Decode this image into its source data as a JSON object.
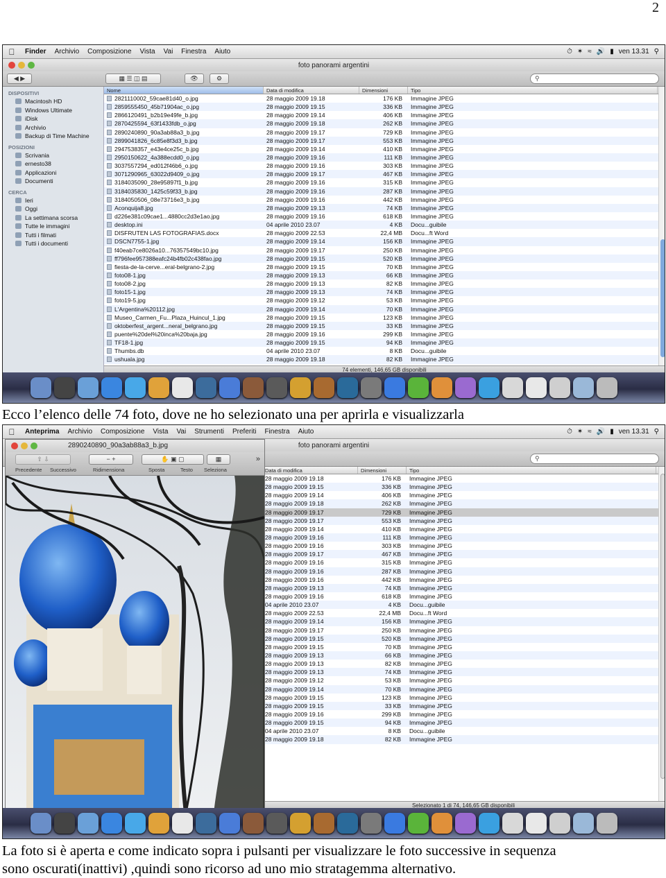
{
  "page_number": "2",
  "caption1": "Ecco l’elenco delle 74 foto, dove ne ho selezionato una per aprirla e visualizzarla",
  "caption2_line1": "La foto si è aperta e come indicato sopra i pulsanti per visualizzare le foto successive in sequenza",
  "caption2_line2": "sono oscurati(inattivi) ,quindi sono ricorso ad uno mio stratagemma alternativo.",
  "shot1": {
    "menu": [
      "Finder",
      "Archivio",
      "Composizione",
      "Vista",
      "Vai",
      "Finestra",
      "Aiuto"
    ],
    "clock": "ven 13.31",
    "window_title": "foto panorami argentini",
    "sidebar": {
      "dispositivi": "DISPOSITIVI",
      "devices": [
        "Macintosh HD",
        "Windows Ultimate",
        "iDisk",
        "Archivio",
        "Backup di Time Machine"
      ],
      "posizioni": "POSIZIONI",
      "places": [
        "Scrivania",
        "ernesto38",
        "Applicazioni",
        "Documenti"
      ],
      "cerca": "CERCA",
      "searches": [
        "Ieri",
        "Oggi",
        "La settimana scorsa",
        "Tutte le immagini",
        "Tutti i filmati",
        "Tutti i documenti"
      ]
    },
    "columns": [
      "Nome",
      "Data di modifica",
      "Dimensioni",
      "Tipo"
    ],
    "status": "74 elementi, 146,65 GB disponibili"
  },
  "files": [
    [
      "2821110002_59cae81d40_o.jpg",
      "28 maggio 2009 19.18",
      "176 KB",
      "Immagine JPEG"
    ],
    [
      "2859555450_45b71904ac_o.jpg",
      "28 maggio 2009 19.15",
      "336 KB",
      "Immagine JPEG"
    ],
    [
      "2866120491_b2b19e49fe_b.jpg",
      "28 maggio 2009 19.14",
      "406 KB",
      "Immagine JPEG"
    ],
    [
      "2870425594_63f1433fdb_o.jpg",
      "28 maggio 2009 19.18",
      "262 KB",
      "Immagine JPEG"
    ],
    [
      "2890240890_90a3ab88a3_b.jpg",
      "28 maggio 2009 19.17",
      "729 KB",
      "Immagine JPEG"
    ],
    [
      "2899041826_6c85e8f3d3_b.jpg",
      "28 maggio 2009 19.17",
      "553 KB",
      "Immagine JPEG"
    ],
    [
      "2947538357_e43e4ce25c_b.jpg",
      "28 maggio 2009 19.14",
      "410 KB",
      "Immagine JPEG"
    ],
    [
      "2950150622_4a388ecdd0_o.jpg",
      "28 maggio 2009 19.16",
      "111 KB",
      "Immagine JPEG"
    ],
    [
      "3037557294_ed012f46b6_o.jpg",
      "28 maggio 2009 19.16",
      "303 KB",
      "Immagine JPEG"
    ],
    [
      "3071290965_63022d9409_o.jpg",
      "28 maggio 2009 19.17",
      "467 KB",
      "Immagine JPEG"
    ],
    [
      "3184035090_28e95897f1_b.jpg",
      "28 maggio 2009 19.16",
      "315 KB",
      "Immagine JPEG"
    ],
    [
      "3184035830_1425c59f33_b.jpg",
      "28 maggio 2009 19.16",
      "287 KB",
      "Immagine JPEG"
    ],
    [
      "3184050506_08e73716e3_b.jpg",
      "28 maggio 2009 19.16",
      "442 KB",
      "Immagine JPEG"
    ],
    [
      "Aconquija8.jpg",
      "28 maggio 2009 19.13",
      "74 KB",
      "Immagine JPEG"
    ],
    [
      "d226e381c09cae1...4880cc2d3e1ao.jpg",
      "28 maggio 2009 19.16",
      "618 KB",
      "Immagine JPEG"
    ],
    [
      "desktop.ini",
      "04 aprile 2010 23.07",
      "4 KB",
      "Docu...guibile"
    ],
    [
      "DISFRUTEN LAS FOTOGRAFIAS.docx",
      "28 maggio 2009 22.53",
      "22,4 MB",
      "Docu...ft Word"
    ],
    [
      "DSCN7755-1.jpg",
      "28 maggio 2009 19.14",
      "156 KB",
      "Immagine JPEG"
    ],
    [
      "f40eab7ce8026a10...76357549bc10.jpg",
      "28 maggio 2009 19.17",
      "250 KB",
      "Immagine JPEG"
    ],
    [
      "ff796fee957388eafc24b4fb02c438fao.jpg",
      "28 maggio 2009 19.15",
      "520 KB",
      "Immagine JPEG"
    ],
    [
      "fiesta-de-la-cerve...eral-belgrano-2.jpg",
      "28 maggio 2009 19.15",
      "70 KB",
      "Immagine JPEG"
    ],
    [
      "foto08-1.jpg",
      "28 maggio 2009 19.13",
      "66 KB",
      "Immagine JPEG"
    ],
    [
      "foto08-2.jpg",
      "28 maggio 2009 19.13",
      "82 KB",
      "Immagine JPEG"
    ],
    [
      "foto15-1.jpg",
      "28 maggio 2009 19.13",
      "74 KB",
      "Immagine JPEG"
    ],
    [
      "foto19-5.jpg",
      "28 maggio 2009 19.12",
      "53 KB",
      "Immagine JPEG"
    ],
    [
      "L'Argentina%20112.jpg",
      "28 maggio 2009 19.14",
      "70 KB",
      "Immagine JPEG"
    ],
    [
      "Museo_Carmen_Fu...Plaza_Huincul_1.jpg",
      "28 maggio 2009 19.15",
      "123 KB",
      "Immagine JPEG"
    ],
    [
      "oktoberfest_argent...neral_belgrano.jpg",
      "28 maggio 2009 19.15",
      "33 KB",
      "Immagine JPEG"
    ],
    [
      "puente%20del%20inca%20baja.jpg",
      "28 maggio 2009 19.16",
      "299 KB",
      "Immagine JPEG"
    ],
    [
      "TF18-1.jpg",
      "28 maggio 2009 19.15",
      "94 KB",
      "Immagine JPEG"
    ],
    [
      "Thumbs.db",
      "04 aprile 2010 23.07",
      "8 KB",
      "Docu...guibile"
    ],
    [
      "ushuala.jpg",
      "28 maggio 2009 19.18",
      "82 KB",
      "Immagine JPEG"
    ]
  ],
  "shot2": {
    "menu": [
      "Anteprima",
      "Archivio",
      "Composizione",
      "Vista",
      "Vai",
      "Strumenti",
      "Preferiti",
      "Finestra",
      "Aiuto"
    ],
    "clock": "ven 13.31",
    "preview_title": "2890240890_90a3ab88a3_b.jpg",
    "preview_tools": [
      "Precedente",
      "Successivo",
      "Ridimensiona",
      "Sposta",
      "Testo",
      "Seleziona"
    ],
    "window_title": "foto panorami argentini",
    "columns": [
      "Data di modifica",
      "Dimensioni",
      "Tipo"
    ],
    "status": "Selezionato 1 di 74, 146,65 GB disponibili"
  },
  "colors": {
    "selection": "#c9c9c9",
    "sidebar": "#dfe4ea",
    "accent": "#7fa9dd"
  }
}
